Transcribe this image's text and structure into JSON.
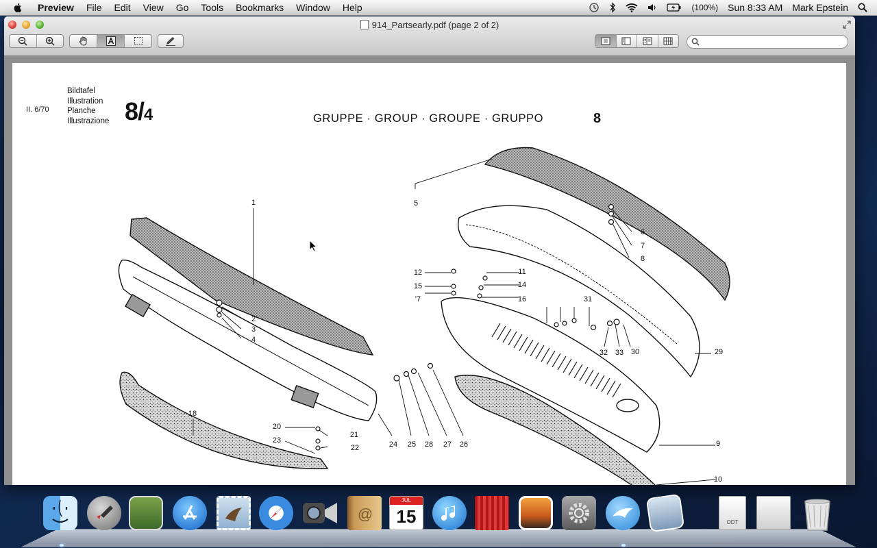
{
  "menubar": {
    "app_name": "Preview",
    "items": [
      "File",
      "Edit",
      "View",
      "Go",
      "Tools",
      "Bookmarks",
      "Window",
      "Help"
    ],
    "battery": "(100%)",
    "clock": "Sun 8:33 AM",
    "user": "Mark Epstein"
  },
  "window": {
    "title": "914_Partsearly.pdf (page 2 of 2)",
    "search_placeholder": ""
  },
  "document": {
    "header_left": "II. 6/70",
    "header_languages": [
      "Bildtafel",
      "Illustration",
      "Planche",
      "Illustrazione"
    ],
    "plate_number_main": "8/",
    "plate_number_sub": "4",
    "group_title": "GRUPPE · GROUP · GROUPE · GRUPPO",
    "group_number": "8",
    "part_labels": [
      "1",
      "2",
      "3",
      "4",
      "5",
      "6",
      "7",
      "8",
      "9",
      "10",
      "11",
      "12",
      "14",
      "15",
      "16",
      "'7",
      "18",
      "20",
      "21",
      "22",
      "23",
      "24",
      "25",
      "26",
      "27",
      "28",
      "29",
      "30",
      "31",
      "32",
      "33"
    ]
  },
  "dock": {
    "items": [
      "Finder",
      "Launchpad",
      "Photo Booth",
      "App Store",
      "Mail",
      "Safari",
      "FaceTime",
      "Address Book",
      "iCal",
      "iTunes",
      "Photo Booth",
      "iPhoto",
      "System Preferences",
      "Preview",
      "Image Capture",
      "ODT Document",
      "Downloads Stack",
      "Trash"
    ],
    "odt_label": "ODT",
    "calendar_month": "JUL",
    "calendar_day": "15"
  },
  "colors": {
    "menubar": "#e8e8e8",
    "window_chrome": "#c8c8c8",
    "doc_background": "#8f8f8f",
    "desktop": "#16345f"
  }
}
